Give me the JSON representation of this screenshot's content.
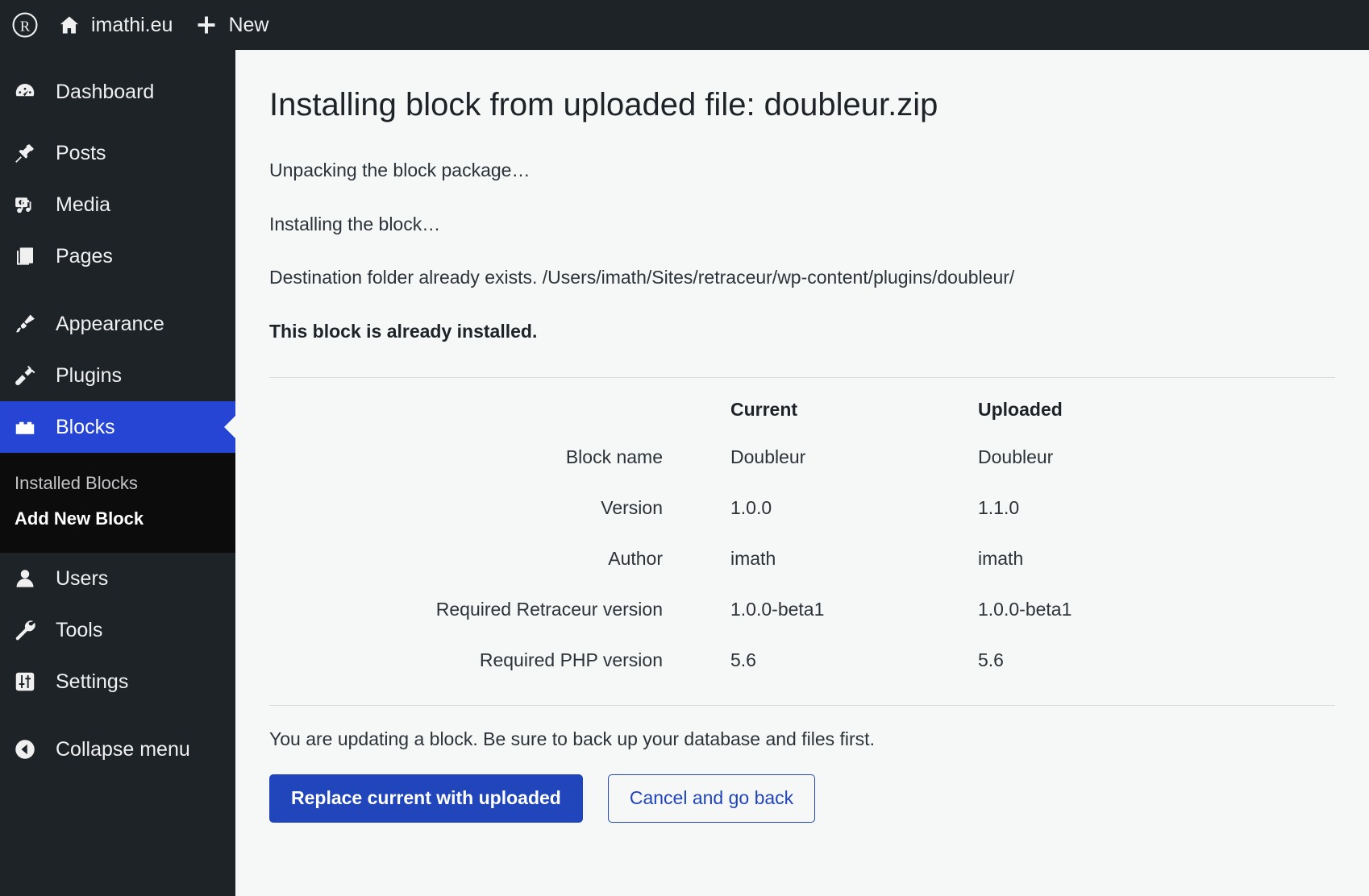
{
  "adminbar": {
    "logo_icon": "wordpress-logo-icon",
    "site_name": "imathi.eu",
    "site_icon": "home-icon",
    "new_label": "New",
    "new_icon": "plus-icon"
  },
  "sidebar": {
    "items": [
      {
        "label": "Dashboard",
        "icon": "dashboard-icon",
        "current": false
      },
      {
        "label": "Posts",
        "icon": "pin-icon",
        "current": false
      },
      {
        "label": "Media",
        "icon": "media-icon",
        "current": false
      },
      {
        "label": "Pages",
        "icon": "pages-icon",
        "current": false
      },
      {
        "label": "Appearance",
        "icon": "paintbrush-icon",
        "current": false
      },
      {
        "label": "Plugins",
        "icon": "plug-icon",
        "current": false
      },
      {
        "label": "Blocks",
        "icon": "block-icon",
        "current": true
      },
      {
        "label": "Users",
        "icon": "user-icon",
        "current": false
      },
      {
        "label": "Tools",
        "icon": "wrench-icon",
        "current": false
      },
      {
        "label": "Settings",
        "icon": "sliders-icon",
        "current": false
      }
    ],
    "submenu": [
      {
        "label": "Installed Blocks",
        "current": false
      },
      {
        "label": "Add New Block",
        "current": true
      }
    ],
    "collapse": {
      "label": "Collapse menu",
      "icon": "collapse-arrow-icon"
    },
    "highlight_color": "#2645d4"
  },
  "main": {
    "title": "Installing block from uploaded file: doubleur.zip",
    "log_lines": [
      "Unpacking the block package…",
      "Installing the block…",
      "Destination folder already exists. /Users/imath/Sites/retraceur/wp-content/plugins/doubleur/"
    ],
    "status_message": "This block is already installed.",
    "table": {
      "columns": [
        "",
        "Current",
        "Uploaded"
      ],
      "rows": [
        {
          "label": "Block name",
          "current": "Doubleur",
          "uploaded": "Doubleur"
        },
        {
          "label": "Version",
          "current": "1.0.0",
          "uploaded": "1.1.0"
        },
        {
          "label": "Author",
          "current": "imath",
          "uploaded": "imath"
        },
        {
          "label": "Required Retraceur version",
          "current": "1.0.0-beta1",
          "uploaded": "1.0.0-beta1"
        },
        {
          "label": "Required PHP version",
          "current": "5.6",
          "uploaded": "5.6"
        }
      ]
    },
    "warning": "You are updating a block. Be sure to back up your database and files first.",
    "buttons": {
      "primary": "Replace current with uploaded",
      "secondary": "Cancel and go back",
      "primary_color": "#2145ba"
    }
  }
}
